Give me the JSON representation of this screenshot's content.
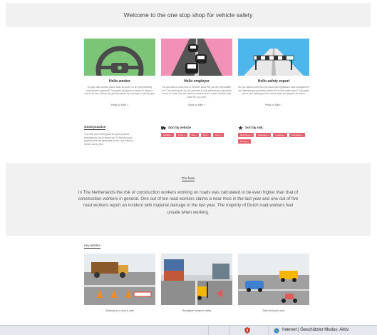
{
  "header": {
    "title": "Welcome to the one stop shop for vehicle safety"
  },
  "cards": [
    {
      "title": "Hello worker",
      "description": "Do you have worries about roads as work? Or are you travelling somewhere in general? This guide will give you hands-on ideas on how to do that. Search the good practices by road type or activity type.",
      "link": "Read on Mille >",
      "color": "#7cc576"
    },
    {
      "title": "Hello employer",
      "description": "Do you want to know how of the work place risk you are responsible for? This guide gives you an overview of cost efficient good practices to use on roads that are used by workers and to create a better work place for your staff.",
      "link": "Read on Mille >",
      "color": "#f291b5"
    },
    {
      "title": "Hello safety expert",
      "description": "Do you want an overview over laws and regulations risks management and effective good practices within the vehicle safety area? This guide will be your starting point to review facts and prepare for action.",
      "link": "Read on Mille >",
      "color": "#4db6ea"
    }
  ],
  "good_practice": {
    "title": "Good practice",
    "text": "The main part of this guide are good practice examples for you to learn from. To find the good practices that are applicable to you, sort them by vehicle and by risk."
  },
  "sort_vehicle": {
    "title": "Sort by vehicle",
    "chips": [
      "Forklift +",
      "Truck +",
      "Car +",
      "Bus +",
      "Lorry +"
    ]
  },
  "sort_risk": {
    "title": "Sort by risk",
    "chips": [
      "Reversing +",
      "Speeding +",
      "Loading +",
      "Unloading +",
      "Driving +"
    ]
  },
  "facts": {
    "title": "The facts",
    "text": "In The Netherlands the risk of construction workers working on roads was calculated to be even higher than that of construction workers in general. One out of ten road workers claims a near miss in the last year and one out of five road workers report an incident with material damage in the last year. The majority of Dutch road workers feel unsafe when working."
  },
  "key_articles": {
    "title": "Key articles",
    "items": [
      {
        "caption": "Working on or near a road"
      },
      {
        "caption": "Workplace transport safety"
      },
      {
        "caption": "Safe driving for work"
      }
    ]
  },
  "statusbar": {
    "text": "Internet | Geschützter Modus: Aktiv"
  },
  "colors": {
    "accent": "#e5606e",
    "band": "#f1f1f1",
    "green": "#7cc576",
    "pink": "#f291b5",
    "blue": "#4db6ea"
  }
}
